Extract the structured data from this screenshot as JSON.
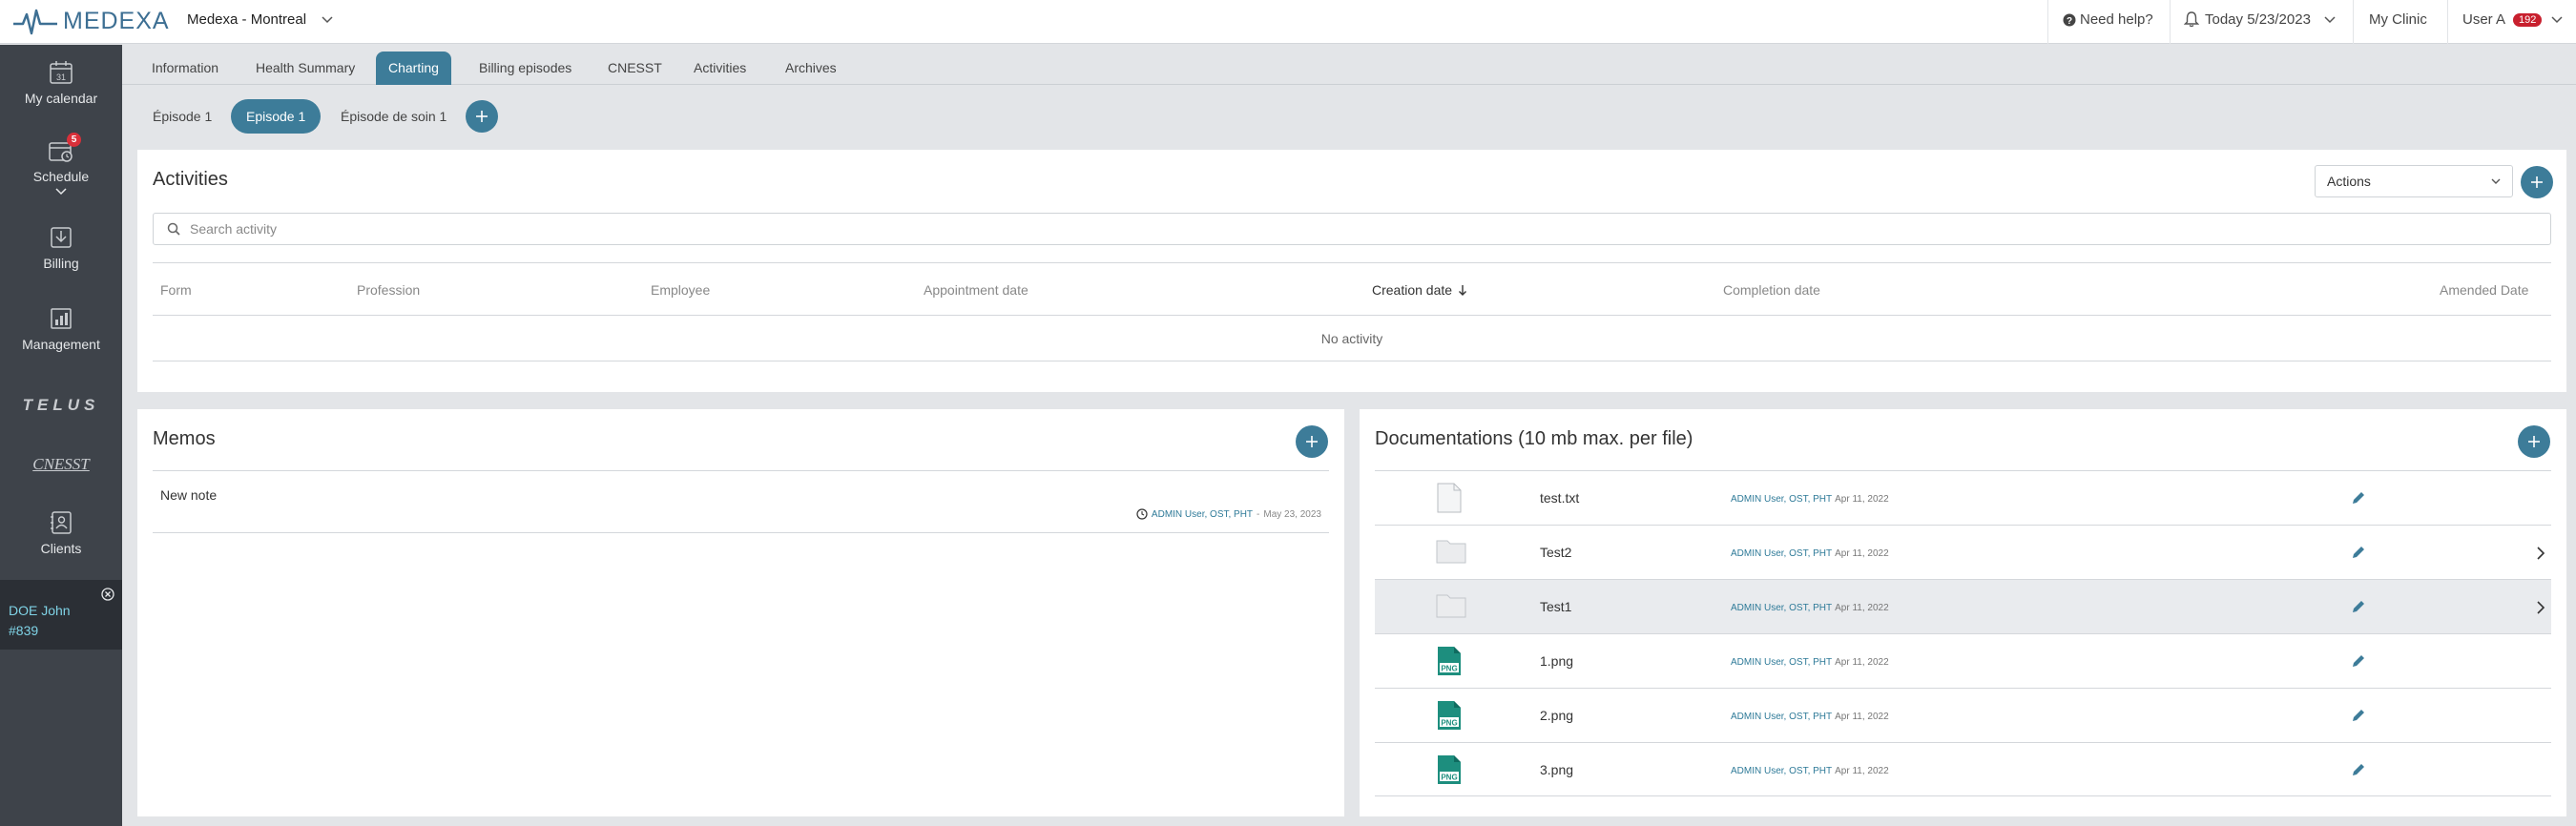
{
  "topbar": {
    "logo_text": "MEDEXA",
    "clinic": "Medexa - Montreal",
    "help": "Need help?",
    "today": "Today 5/23/2023",
    "my_clinic": "My Clinic",
    "user": "User A",
    "user_badge": "192"
  },
  "sidebar": {
    "items": [
      {
        "label": "My calendar",
        "icon": "calendar-icon",
        "icon_text": "31"
      },
      {
        "label": "Schedule",
        "icon": "schedule-icon",
        "badge": "5"
      },
      {
        "label": "Billing",
        "icon": "billing-icon"
      },
      {
        "label": "Management",
        "icon": "management-icon"
      },
      {
        "label": "Clients",
        "icon": "clients-icon"
      }
    ],
    "partners": [
      "TELUS",
      "CNESST"
    ],
    "patient": {
      "name": "DOE John",
      "id": "#839"
    }
  },
  "tabs": [
    "Information",
    "Health Summary",
    "Charting",
    "Billing episodes",
    "CNESST",
    "Activities",
    "Archives"
  ],
  "active_tab": "Charting",
  "episodes": [
    "Épisode 1",
    "Episode 1",
    "Épisode de soin 1"
  ],
  "active_episode": "Episode 1",
  "activities": {
    "title": "Activities",
    "actions_label": "Actions",
    "search_placeholder": "Search activity",
    "columns": [
      "Form",
      "Profession",
      "Employee",
      "Appointment date",
      "Creation date",
      "Completion date",
      "Amended Date"
    ],
    "sorted_column": "Creation date",
    "empty_text": "No activity"
  },
  "memos": {
    "title": "Memos",
    "items": [
      {
        "text": "New note",
        "author": "ADMIN User, OST, PHT",
        "separator": "-",
        "date": "May 23, 2023"
      }
    ]
  },
  "docs": {
    "title": "Documentations (10 mb max. per file)",
    "items": [
      {
        "name": "test.txt",
        "type": "file",
        "author": "ADMIN User, OST, PHT",
        "date": "Apr 11, 2022",
        "chevron": false
      },
      {
        "name": "Test2",
        "type": "folder",
        "author": "ADMIN User, OST, PHT",
        "date": "Apr 11, 2022",
        "chevron": true
      },
      {
        "name": "Test1",
        "type": "folder",
        "author": "ADMIN User, OST, PHT",
        "date": "Apr 11, 2022",
        "chevron": true
      },
      {
        "name": "1.png",
        "type": "png",
        "author": "ADMIN User, OST, PHT",
        "date": "Apr 11, 2022",
        "chevron": false
      },
      {
        "name": "2.png",
        "type": "png",
        "author": "ADMIN User, OST, PHT",
        "date": "Apr 11, 2022",
        "chevron": false
      },
      {
        "name": "3.png",
        "type": "png",
        "author": "ADMIN User, OST, PHT",
        "date": "Apr 11, 2022",
        "chevron": false
      }
    ],
    "png_label": "PNG"
  },
  "colors": {
    "accent": "#3d7c99",
    "sidebar": "#3e434a",
    "link": "#2e7a98",
    "badge": "#c8202e"
  }
}
